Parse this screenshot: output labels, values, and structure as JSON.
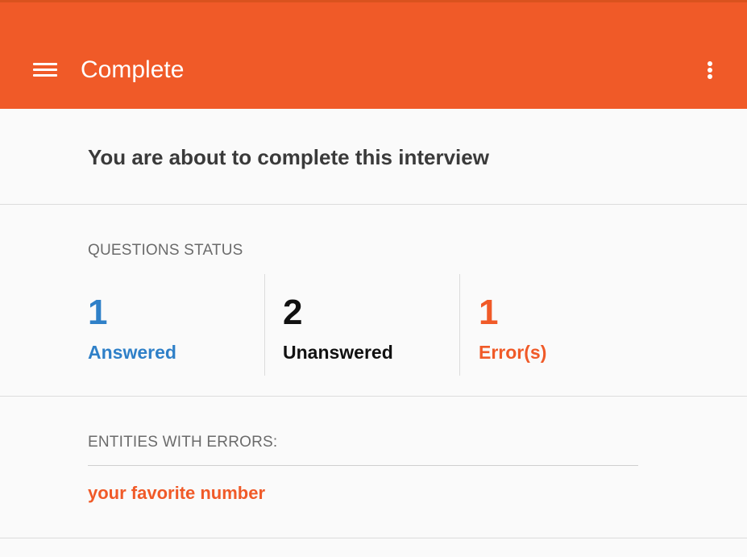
{
  "toolbar": {
    "title": "Complete",
    "menu_icon": "hamburger-menu-icon",
    "overflow_icon": "more-vertical-icon",
    "color": "#f05a28"
  },
  "main": {
    "heading": "You are about to complete this interview"
  },
  "questions_status": {
    "label": "QUESTIONS STATUS",
    "answered": {
      "count": "1",
      "label": "Answered",
      "color": "#2f80c8"
    },
    "unanswered": {
      "count": "2",
      "label": "Unanswered",
      "color": "#111111"
    },
    "errors": {
      "count": "1",
      "label": "Error(s)",
      "color": "#f05a28"
    }
  },
  "entities_with_errors": {
    "label": "ENTITIES WITH ERRORS:",
    "items": [
      {
        "label": "your favorite number"
      }
    ]
  }
}
